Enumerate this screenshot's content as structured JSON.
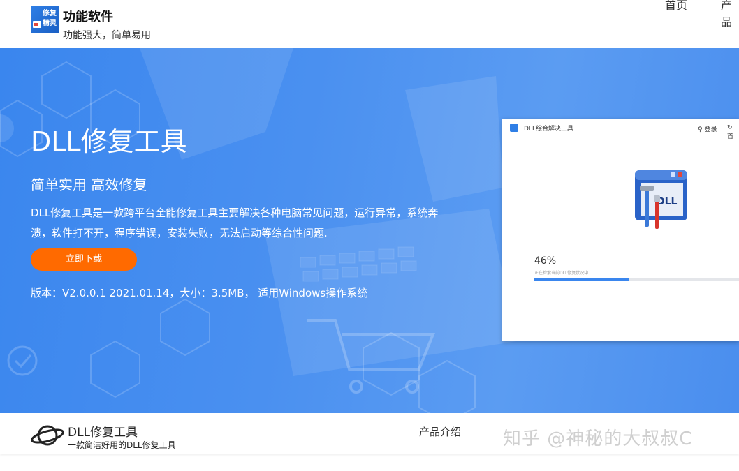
{
  "header": {
    "logo_text_line1": "修复",
    "logo_text_line2": "精灵",
    "brand_title": "功能软件",
    "brand_subtitle": "功能强大，简单易用",
    "nav": [
      "首页",
      "产品"
    ]
  },
  "hero": {
    "title": "DLL修复工具",
    "slogan": "简单实用 高效修复",
    "description": "DLL修复工具是一款跨平台全能修复工具主要解决各种电脑常见问题，运行异常，系统奔溃，软件打不开，程序错误，安装失败，无法启动等综合性问题.",
    "download_label": "立即下载",
    "version_info": "版本：V2.0.0.1 2021.01.14，大小：3.5MB， 适用Windows操作系统"
  },
  "app_window": {
    "title": "DLL综合解决工具",
    "login_label": "登录",
    "home_label": "首",
    "icon_label": "DLL",
    "progress_percent_text": "46%",
    "progress_value": 0.46,
    "progress_status": "正在检索当前DLL修复状况中..."
  },
  "footer": {
    "title": "DLL修复工具",
    "subtitle": "一款简洁好用的DLL修复工具",
    "link_label": "产品介绍",
    "watermark": "知乎 @神秘的大叔叔C"
  },
  "colors": {
    "hero_blue": "#3a86ee",
    "download_orange": "#ff6a00",
    "progress_blue": "#3a86ee"
  }
}
